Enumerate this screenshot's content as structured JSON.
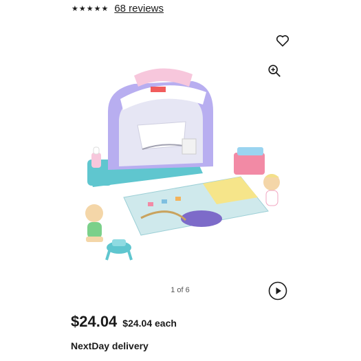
{
  "rating": {
    "stars": "★★★★★",
    "reviews_label": "68 reviews"
  },
  "icons": {
    "favorite": "heart-outline-icon",
    "zoom": "zoom-in-icon",
    "video": "play-icon"
  },
  "gallery": {
    "counter": "1 of 6"
  },
  "price": {
    "amount": "$24.04",
    "unit_price": "$24.04 each"
  },
  "delivery": {
    "label": "NextDay delivery"
  },
  "colors": {
    "text": "#1a1a1a",
    "muted": "#555555",
    "house_purple": "#b8aef0",
    "roof_pink": "#f7c7dc",
    "base_teal": "#5fc6cf"
  }
}
